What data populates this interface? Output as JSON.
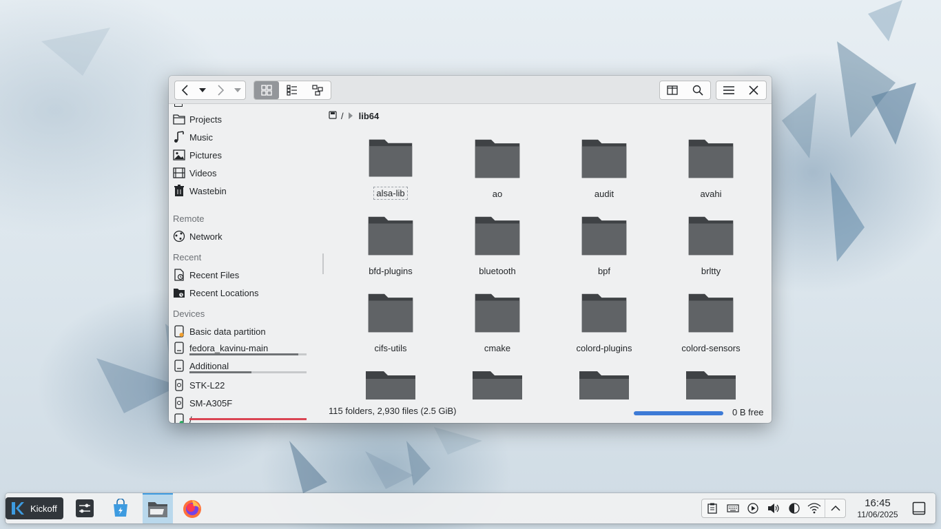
{
  "wallpaper": {
    "name": "abstract-shards-wallpaper"
  },
  "window": {
    "toolbar": {
      "back_icon": "back-arrow-icon",
      "forward_icon": "forward-arrow-icon",
      "view_modes": [
        "icons-view-icon",
        "compact-view-icon",
        "details-view-icon"
      ],
      "split_icon": "split-view-icon",
      "search_icon": "search-icon",
      "menu_icon": "hamburger-menu-icon",
      "close_icon": "close-icon"
    },
    "sidebar": {
      "places": [
        {
          "label": "Projects",
          "icon": "folder-icon"
        },
        {
          "label": "Music",
          "icon": "music-icon"
        },
        {
          "label": "Pictures",
          "icon": "pictures-icon"
        },
        {
          "label": "Videos",
          "icon": "videos-icon"
        },
        {
          "label": "Wastebin",
          "icon": "trash-icon"
        }
      ],
      "remote_heading": "Remote",
      "remote": [
        {
          "label": "Network",
          "icon": "network-icon"
        }
      ],
      "recent_heading": "Recent",
      "recent": [
        {
          "label": "Recent Files",
          "icon": "recent-files-icon"
        },
        {
          "label": "Recent Locations",
          "icon": "recent-locations-icon"
        }
      ],
      "devices_heading": "Devices",
      "devices": [
        {
          "label": "Basic data partition",
          "icon": "drive-icon"
        },
        {
          "label": "fedora_kavinu-main",
          "icon": "drive-icon",
          "usage": 0.93
        },
        {
          "label": "Additional",
          "icon": "drive-icon",
          "usage": 0.53
        },
        {
          "label": "STK-L22",
          "icon": "phone-icon"
        },
        {
          "label": "SM-A305F",
          "icon": "phone-icon"
        },
        {
          "label": "/",
          "icon": "root-drive-icon",
          "usage": 1.0,
          "usage_color": "#da4453"
        }
      ]
    },
    "breadcrumb": {
      "root": "/",
      "current": "lib64"
    },
    "folders": [
      "alsa-lib",
      "ao",
      "audit",
      "avahi",
      "bfd-plugins",
      "bluetooth",
      "bpf",
      "brltty",
      "cifs-utils",
      "cmake",
      "colord-plugins",
      "colord-sensors",
      "",
      "",
      "",
      ""
    ],
    "status": {
      "summary": "115 folders, 2,930 files (2.5 GiB)",
      "free": "0 B free",
      "free_bar_color": "#3d7bd6"
    }
  },
  "taskbar": {
    "kickoff_label": "Kickoff",
    "tasks": [
      "system-settings-icon",
      "discover-store-icon",
      "dolphin-file-manager-icon",
      "firefox-icon"
    ],
    "tray": [
      "clipboard-icon",
      "keyboard-icon",
      "media-player-icon",
      "volume-icon",
      "night-color-icon",
      "wifi-icon",
      "expand-tray-icon"
    ],
    "time": "16:45",
    "date": "11/06/2025"
  }
}
